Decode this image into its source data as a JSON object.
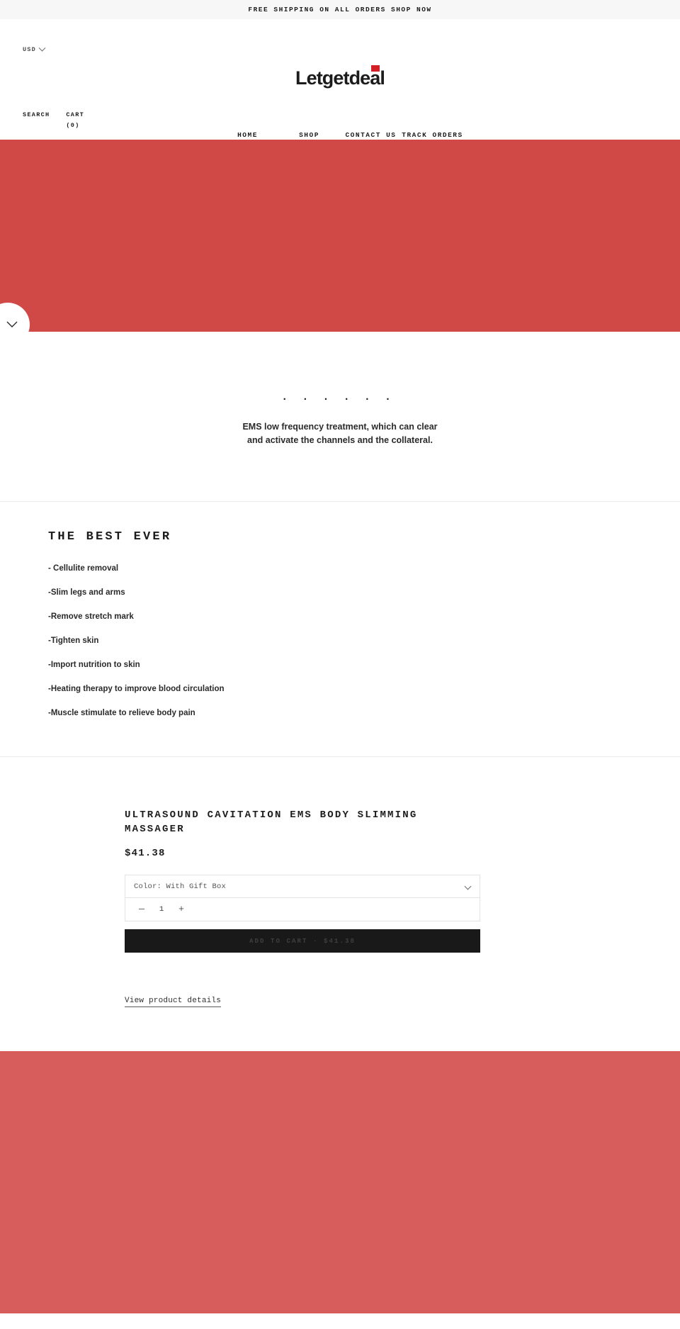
{
  "announcement": {
    "text": "FREE SHIPPING ON ALL ORDERS SHOP NOW"
  },
  "header": {
    "currency": {
      "label": "USD",
      "icon": "chevron-down-icon"
    },
    "logo": {
      "text": "Letgetdeal",
      "accent_color": "#d31f26"
    },
    "utility": {
      "search_label": "SEARCH",
      "cart_label": "CART (0)",
      "cart_label_line1": "CART",
      "cart_label_line2": "(0)"
    },
    "nav": [
      {
        "label": "HOME",
        "active": true
      },
      {
        "label": "SHOP",
        "active": false
      },
      {
        "label": "CONTACT US",
        "active": false
      },
      {
        "label": "TRACK ORDERS",
        "active": false
      }
    ]
  },
  "hero": {
    "background_color": "#d04947",
    "scroll_button_icon": "chevron-down-icon"
  },
  "feature_block": {
    "dots": "· · · · · ·",
    "copy": "EMS low frequency treatment, which can clear and activate the channels and the collateral."
  },
  "best_section": {
    "title": "THE BEST EVER",
    "items": [
      "- Cellulite removal",
      "-Slim legs and arms",
      "-Remove stretch mark",
      "-Tighten skin",
      "-Import nutrition to skin",
      "-Heating therapy to improve blood circulation",
      "-Muscle stimulate to relieve body pain"
    ]
  },
  "product": {
    "title": "ULTRASOUND CAVITATION EMS BODY SLIMMING MASSAGER",
    "price": "$41.38",
    "variant": {
      "selected": "Color: With Gift Box",
      "caret_icon": "chevron-down-icon"
    },
    "quantity": {
      "minus_label": "—",
      "value": "1",
      "plus_label": "+"
    },
    "add_to_cart_label": "ADD TO CART · $41.38",
    "details_link_label": "View product details"
  },
  "bottom_banner": {
    "background_color": "#d75c5c"
  }
}
